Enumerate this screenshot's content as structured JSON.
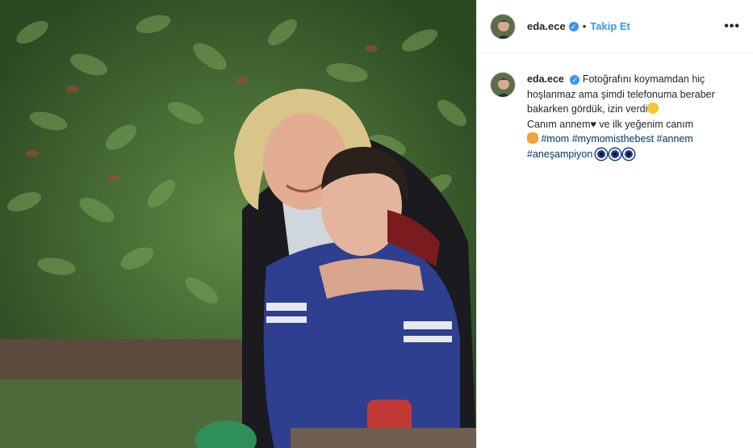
{
  "header": {
    "username": "eda.ece",
    "separator": "•",
    "follow_label": "Takip Et",
    "more_label": "•••"
  },
  "caption": {
    "username": "eda.ece",
    "line1": "Fotoğrafını koymamdan hiç hoşlanmaz ama şimdi telefonuma beraber bakarken gördük, izin verdi",
    "line2a": "Canım annem",
    "heart": "♥",
    "line2b": "ve ilk yeğenim canım",
    "hashtags": [
      "#mom",
      "#mymomisthebest",
      "#annem",
      "#aneşampiyon"
    ]
  },
  "icons": {
    "verified": "verified-badge-icon",
    "more": "more-options-icon",
    "grin": "grinning-face-emoji",
    "cat": "cat-face-emoji",
    "evil_eye": "evil-eye-emoji"
  },
  "colors": {
    "link": "#3897f0",
    "hashtag": "#003569",
    "text": "#262626"
  }
}
